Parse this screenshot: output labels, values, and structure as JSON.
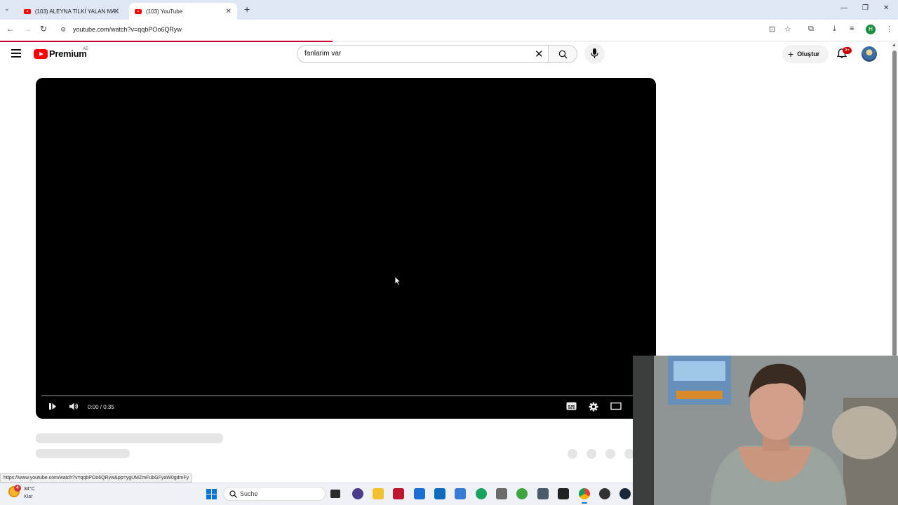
{
  "browser": {
    "tabs": [
      {
        "title": "(103) ALEYNA TİLKİ YALAN MA..."
      },
      {
        "title": "(103) YouTube"
      }
    ],
    "url": "youtube.com/watch?v=qqbPOo6QRyw",
    "profile_initial": "H"
  },
  "youtube": {
    "logo_text": "Premium",
    "region": "AE",
    "search_query": "fanlarim var",
    "create_label": "Oluştur",
    "notification_count": "9+"
  },
  "player": {
    "time": "0:00 / 0:35",
    "progress_fraction": 0
  },
  "page_load_progress_fraction": 0.37,
  "status_link": "https://www.youtube.com/watch?v=qqbPOo6QRyw&pp=ygUMZmFubGFyaW0gdmFy",
  "taskbar": {
    "weather_temp": "34°C",
    "weather_condition": "Klar",
    "weather_badge": "4",
    "search_placeholder": "Suche",
    "apps": [
      "task-view",
      "app-24",
      "file-explorer",
      "mcafee",
      "maps",
      "outlook",
      "microsoft-store",
      "edge",
      "vpn",
      "vmware",
      "iv-app",
      "chrome",
      "obs",
      "steam"
    ]
  },
  "colors": {
    "youtube_red": "#ff0000",
    "progress_red": "#cc0033",
    "chrome_tabstrip": "#dfe7f5",
    "taskbar": "#eef1f6"
  }
}
